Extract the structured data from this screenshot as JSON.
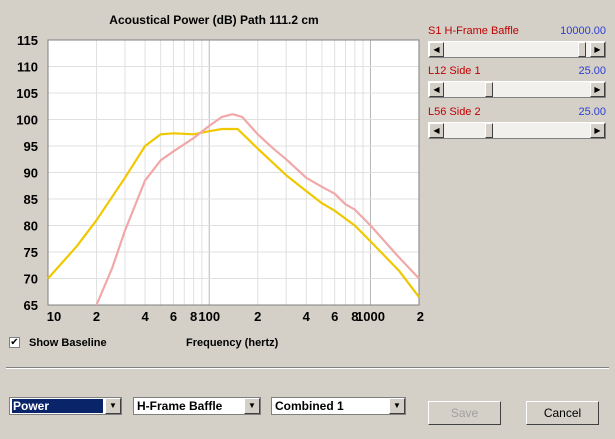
{
  "chart_data": {
    "type": "line",
    "title": "Acoustical Power (dB)   Path 111.2 cm",
    "xlabel": "Frequency (hertz)",
    "ylabel": "",
    "xscale": "log",
    "xlim": [
      10,
      2000
    ],
    "ylim": [
      65,
      115
    ],
    "yticks": [
      115,
      110,
      105,
      100,
      95,
      90,
      85,
      80,
      75,
      70,
      65
    ],
    "xtick_labels": [
      {
        "v": 10,
        "t": "10"
      },
      {
        "v": 20,
        "t": "2"
      },
      {
        "v": 40,
        "t": "4"
      },
      {
        "v": 60,
        "t": "6"
      },
      {
        "v": 80,
        "t": "8"
      },
      {
        "v": 100,
        "t": "100"
      },
      {
        "v": 200,
        "t": "2"
      },
      {
        "v": 400,
        "t": "4"
      },
      {
        "v": 600,
        "t": "6"
      },
      {
        "v": 800,
        "t": "8"
      },
      {
        "v": 1000,
        "t": "1000"
      },
      {
        "v": 2000,
        "t": "2"
      }
    ],
    "grid": true,
    "series": [
      {
        "color": "#f0c800",
        "x": [
          10,
          15,
          20,
          30,
          40,
          50,
          60,
          80,
          100,
          120,
          150,
          200,
          300,
          400,
          500,
          600,
          800,
          1000,
          1500,
          2000
        ],
        "y": [
          70,
          76,
          81,
          89,
          95,
          97.2,
          97.4,
          97.2,
          97.8,
          98.2,
          98.2,
          94.5,
          89.5,
          86.5,
          84.2,
          82.8,
          80,
          77,
          71.5,
          66.5
        ]
      },
      {
        "color": "#f0a8a8",
        "x": [
          20,
          25,
          30,
          40,
          50,
          60,
          80,
          100,
          120,
          140,
          160,
          200,
          250,
          300,
          400,
          500,
          600,
          700,
          800,
          1000,
          1500,
          2000
        ],
        "y": [
          65,
          72,
          79,
          88.5,
          92.3,
          94,
          96.5,
          98.8,
          100.5,
          101,
          100.5,
          97.2,
          94.5,
          92.5,
          89,
          87.3,
          86,
          84,
          83,
          80,
          74,
          70
        ]
      }
    ]
  },
  "params": [
    {
      "label": "S1  H-Frame Baffle",
      "value": "10000.00",
      "position": 0.97
    },
    {
      "label": "L12  Side 1",
      "value": "25.00",
      "position": 0.3
    },
    {
      "label": "L56  Side 2",
      "value": "25.00",
      "position": 0.3
    }
  ],
  "show_baseline": {
    "label": "Show Baseline",
    "checked": true,
    "check_glyph": "✔"
  },
  "dropdowns": {
    "mode": "Power",
    "speaker": "H-Frame Baffle",
    "config": "Combined 1"
  },
  "buttons": {
    "save": "Save",
    "cancel": "Cancel"
  },
  "glyphs": {
    "left": "◀",
    "right": "▶",
    "down": "▼"
  }
}
